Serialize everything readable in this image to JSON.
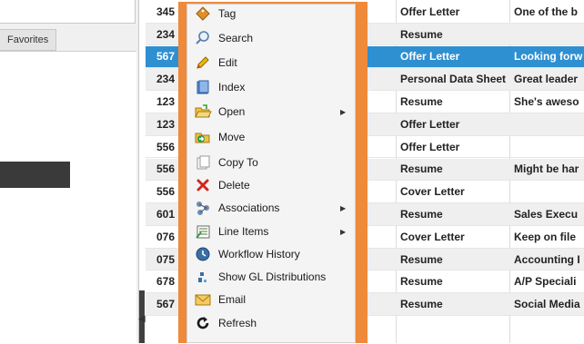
{
  "left_panel": {
    "favorites_tab": "Favorites"
  },
  "grid": {
    "rows": [
      {
        "id": "345",
        "doc_type": "Offer Letter",
        "desc": "One of the b"
      },
      {
        "id": "234",
        "doc_type": "Resume",
        "desc": ""
      },
      {
        "id": "567",
        "doc_type": "Offer Letter",
        "desc": "Looking forw",
        "selected": true
      },
      {
        "id": "234",
        "doc_type": "Personal Data Sheet",
        "desc": "Great leader"
      },
      {
        "id": "123",
        "doc_type": "Resume",
        "desc": "She's aweso"
      },
      {
        "id": "123",
        "doc_type": "Offer Letter",
        "desc": ""
      },
      {
        "id": "556",
        "doc_type": "Offer Letter",
        "desc": ""
      },
      {
        "id": "556",
        "doc_type": "Resume",
        "desc": "Might be har"
      },
      {
        "id": "556",
        "doc_type": "Cover Letter",
        "desc": ""
      },
      {
        "id": "601",
        "doc_type": "Resume",
        "desc": "Sales Execu"
      },
      {
        "id": "076",
        "doc_type": "Cover Letter",
        "desc": "Keep on file"
      },
      {
        "id": "075",
        "doc_type": "Resume",
        "desc": "Accounting I"
      },
      {
        "id": "678",
        "doc_type": "Resume",
        "desc": "A/P Speciali"
      },
      {
        "id": "567",
        "doc_type": "Resume",
        "desc": "Social Media"
      }
    ]
  },
  "context_menu": {
    "items": [
      {
        "label": "Tag",
        "icon": "tag-icon"
      },
      {
        "label": "Search",
        "icon": "search-icon"
      },
      {
        "label": "Edit",
        "icon": "pencil-icon"
      },
      {
        "label": "Index",
        "icon": "index-icon"
      },
      {
        "label": "Open",
        "icon": "folder-open-icon",
        "submenu": true
      },
      {
        "label": "Move",
        "icon": "move-icon"
      },
      {
        "label": "Copy To",
        "icon": "copy-icon"
      },
      {
        "label": "Delete",
        "icon": "delete-x-icon"
      },
      {
        "label": "Associations",
        "icon": "associations-icon",
        "submenu": true
      },
      {
        "label": "Line Items",
        "icon": "line-items-icon",
        "submenu": true
      },
      {
        "label": "Workflow History",
        "icon": "history-icon"
      },
      {
        "label": "Show GL Distributions",
        "icon": "gl-distributions-icon"
      },
      {
        "label": "Email",
        "icon": "email-icon"
      },
      {
        "label": "Refresh",
        "icon": "refresh-icon"
      }
    ],
    "submenu_glyph": "▶"
  },
  "colors": {
    "menu_border": "#ee8a3a",
    "selected_row": "#2e8fd1"
  }
}
